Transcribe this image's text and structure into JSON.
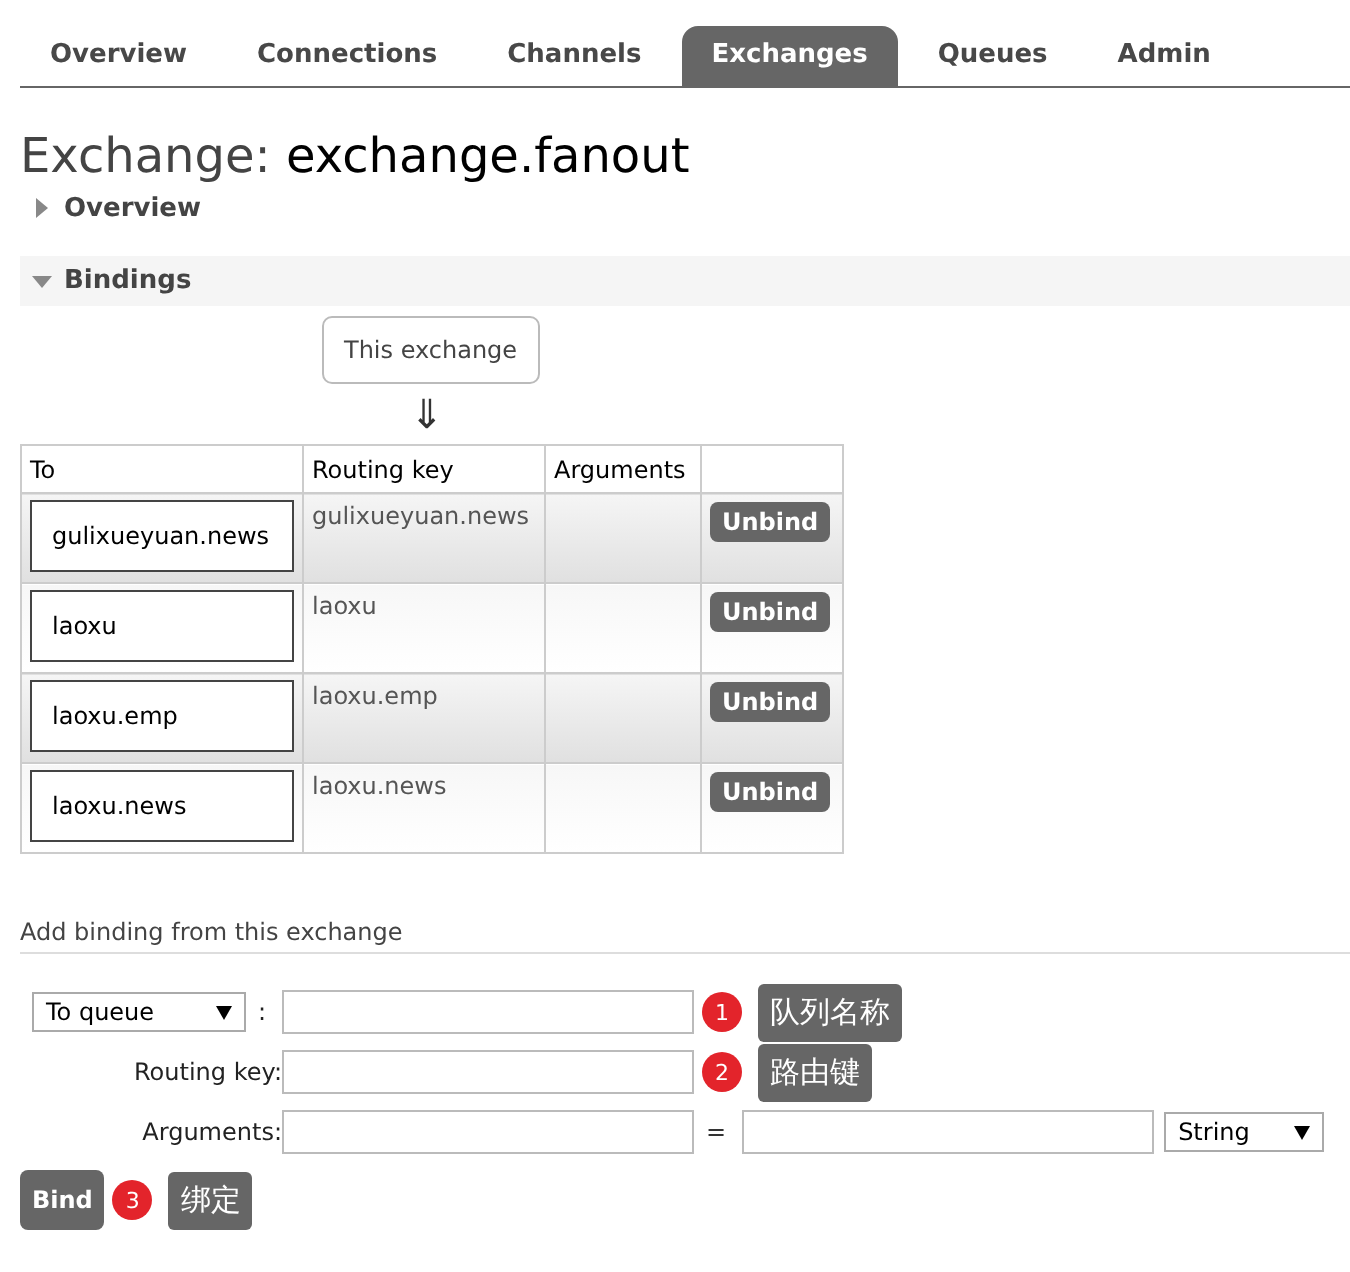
{
  "tabs": [
    {
      "label": "Overview",
      "selected": false
    },
    {
      "label": "Connections",
      "selected": false
    },
    {
      "label": "Channels",
      "selected": false
    },
    {
      "label": "Exchanges",
      "selected": true
    },
    {
      "label": "Queues",
      "selected": false
    },
    {
      "label": "Admin",
      "selected": false
    }
  ],
  "title": {
    "prefix": "Exchange:",
    "name": "exchange.fanout"
  },
  "sections": [
    {
      "label": "Overview",
      "expanded": false
    },
    {
      "label": "Bindings",
      "expanded": true
    }
  ],
  "source_box": "This exchange",
  "flow_arrow": "⇓",
  "table": {
    "columns": [
      "To",
      "Routing key",
      "Arguments"
    ],
    "rows": [
      {
        "to": "gulixueyuan.news",
        "routing_key": "gulixueyuan.news",
        "action": "Unbind"
      },
      {
        "to": "laoxu",
        "routing_key": "laoxu",
        "action": "Unbind"
      },
      {
        "to": "laoxu.emp",
        "routing_key": "laoxu.emp",
        "action": "Unbind"
      },
      {
        "to": "laoxu.news",
        "routing_key": "laoxu.news",
        "action": "Unbind"
      }
    ]
  },
  "add_binding": {
    "heading": "Add binding from this exchange",
    "destination_type": "To queue",
    "colon": ":",
    "routing_key_label": "Routing key:",
    "arguments_label": "Arguments:",
    "equals": "=",
    "argument_type": "String",
    "button": "Bind"
  },
  "annotations": [
    {
      "number": "1",
      "text": "队列名称"
    },
    {
      "number": "2",
      "text": "路由键"
    },
    {
      "number": "3",
      "text": "绑定"
    }
  ]
}
